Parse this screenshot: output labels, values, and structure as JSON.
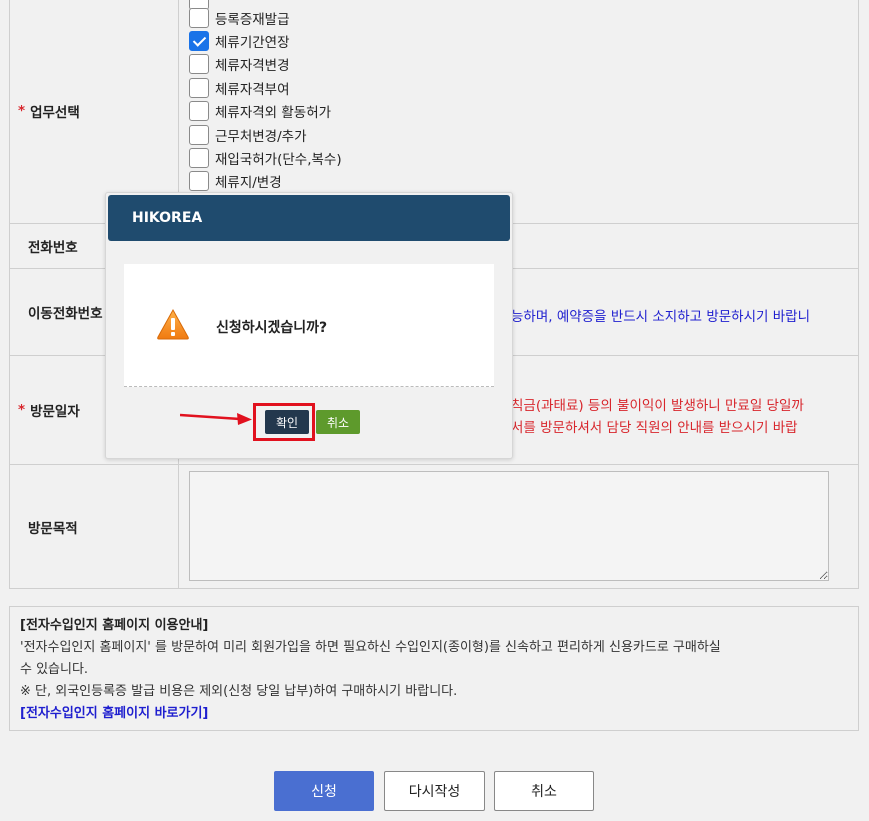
{
  "form": {
    "task": {
      "label": "업무선택",
      "options": [
        {
          "label": "등록증재발급",
          "checked": false
        },
        {
          "label": "체류기간연장",
          "checked": true
        },
        {
          "label": "체류자격변경",
          "checked": false
        },
        {
          "label": "체류자격부여",
          "checked": false
        },
        {
          "label": "체류자격외 활동허가",
          "checked": false
        },
        {
          "label": "근무처변경/추가",
          "checked": false
        },
        {
          "label": "재입국허가(단수,복수)",
          "checked": false
        },
        {
          "label": "체류지/변경",
          "checked": false
        }
      ]
    },
    "phone": {
      "label": "전화번호"
    },
    "mobile": {
      "label": "이동전화번호",
      "notice": "능하며, 예약증을 반드시 소지하고 방문하시기 바랍니"
    },
    "visit_date": {
      "label": "방문일자",
      "notice_line1": "칙금(과태료) 등의 불이익이 발생하니 만료일 당일까",
      "notice_line2": "서를 방문하셔서 담당 직원의 안내를 받으시기 바랍"
    },
    "purpose": {
      "label": "방문목적",
      "value": ""
    }
  },
  "guide": {
    "title": "[전자수입인지 홈페이지 이용안내]",
    "line1": "'전자수입인지 홈페이지' 를 방문하여 미리 회원가입을 하면 필요하신 수입인지(종이형)를 신속하고 편리하게 신용카드로 구매하실",
    "line2": "수 있습니다.",
    "line3": "※ 단, 외국인등록증 발급 비용은 제외(신청 당일 납부)하여 구매하시기 바랍니다.",
    "link": "[전자수입인지 홈페이지 바로가기]"
  },
  "buttons": {
    "submit": "신청",
    "rewrite": "다시작성",
    "cancel": "취소"
  },
  "modal": {
    "title": "HIKOREA",
    "message": "신청하시겠습니까?",
    "ok": "확인",
    "cancel": "취소"
  },
  "colors": {
    "modal_header": "#1f4b6e",
    "ok_button": "#23384d",
    "cancel_button": "#5e9a2c",
    "primary_button": "#4a6fd1",
    "highlight": "#e1111e"
  }
}
